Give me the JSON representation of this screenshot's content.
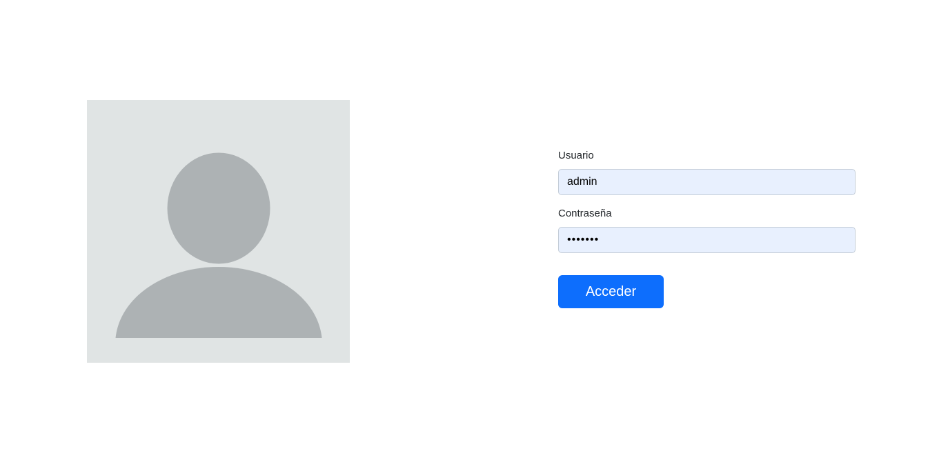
{
  "avatar": {
    "icon": "user-silhouette-icon",
    "background_color": "#e0e4e4",
    "figure_color": "#adb2b4"
  },
  "form": {
    "username_label": "Usuario",
    "username_value": "admin",
    "password_label": "Contraseña",
    "password_value": "•••••••",
    "submit_label": "Acceder"
  },
  "colors": {
    "accent": "#0d6efd",
    "input_background": "#e8f0fe"
  }
}
